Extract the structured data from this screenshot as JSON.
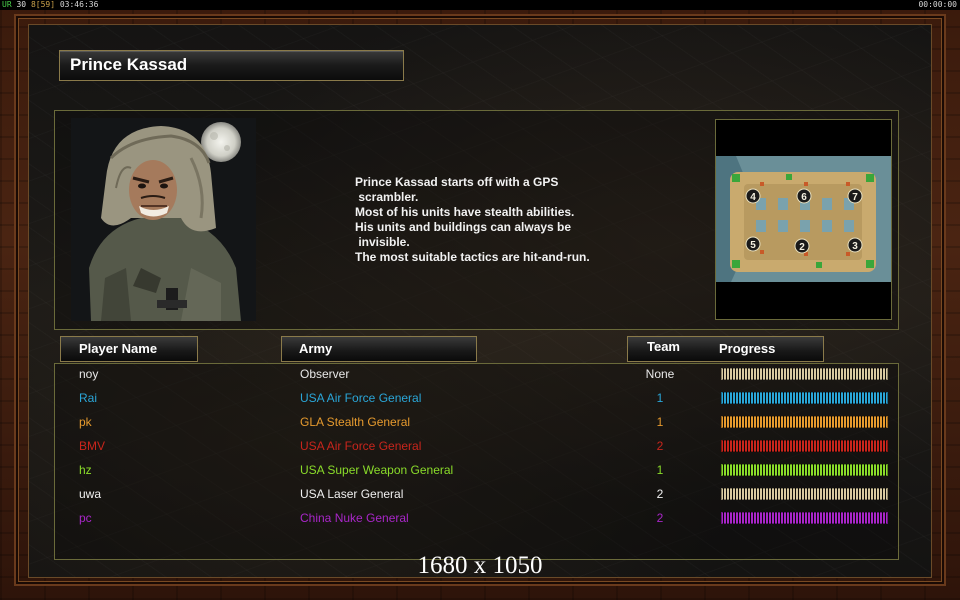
{
  "status_bar": {
    "ur": "UR",
    "fps": "30",
    "frames": "8[59]",
    "time_left": "03:46:36",
    "time_right": "00:00:00"
  },
  "general": {
    "name": "Prince Kassad",
    "description": [
      "Prince Kassad starts off with a GPS",
      " scrambler.",
      "Most of his units have stealth abilities.",
      "His units and buildings can always be",
      " invisible.",
      "The most suitable tactics are hit-and-run."
    ]
  },
  "minimap": {
    "spawn_labels": [
      "4",
      "6",
      "7",
      "5",
      "2",
      "3"
    ]
  },
  "columns": {
    "player_name": "Player Name",
    "army": "Army",
    "team": "Team",
    "progress": "Progress"
  },
  "players": [
    {
      "name": "noy",
      "army": "Observer",
      "team": "None",
      "color": "#e8e8e8",
      "bar_color": "#d8c9a0",
      "progress": 1.0
    },
    {
      "name": "Rai",
      "army": "USA Air Force General",
      "team": "1",
      "color": "#2aa6d8",
      "bar_color": "#2aa6d8",
      "progress": 1.0
    },
    {
      "name": "pk",
      "army": "GLA Stealth General",
      "team": "1",
      "color": "#e69a2e",
      "bar_color": "#e69a2e",
      "progress": 1.0
    },
    {
      "name": "BMV",
      "army": "USA Air Force General",
      "team": "2",
      "color": "#c8251c",
      "bar_color": "#c8251c",
      "progress": 1.0
    },
    {
      "name": "hz",
      "army": "USA Super Weapon General",
      "team": "1",
      "color": "#8adc2a",
      "bar_color": "#8adc2a",
      "progress": 1.0
    },
    {
      "name": "uwa",
      "army": "USA Laser General",
      "team": "2",
      "color": "#f0f0f0",
      "bar_color": "#d8c9a0",
      "progress": 1.0
    },
    {
      "name": "pc",
      "army": "China Nuke General",
      "team": "2",
      "color": "#a826c8",
      "bar_color": "#a826c8",
      "progress": 1.0
    }
  ],
  "resolution": "1680 x 1050"
}
